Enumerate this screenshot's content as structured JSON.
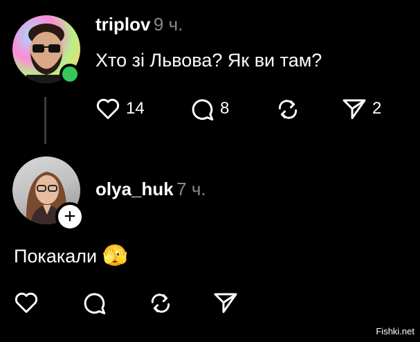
{
  "post": {
    "username": "triplov",
    "time": "9 ч.",
    "text": "Хто зі Львова? Як ви там?",
    "actions": {
      "likes": "14",
      "comments": "8",
      "shares": "2"
    }
  },
  "reply": {
    "username": "olya_huk",
    "time": "7 ч.",
    "text": "Покакали",
    "emoji": "🫣",
    "plus": "+"
  },
  "watermark": "Fishki.net",
  "colors": {
    "background": "#000000",
    "online": "#35c759",
    "secondary_text": "#8a8a8a"
  }
}
